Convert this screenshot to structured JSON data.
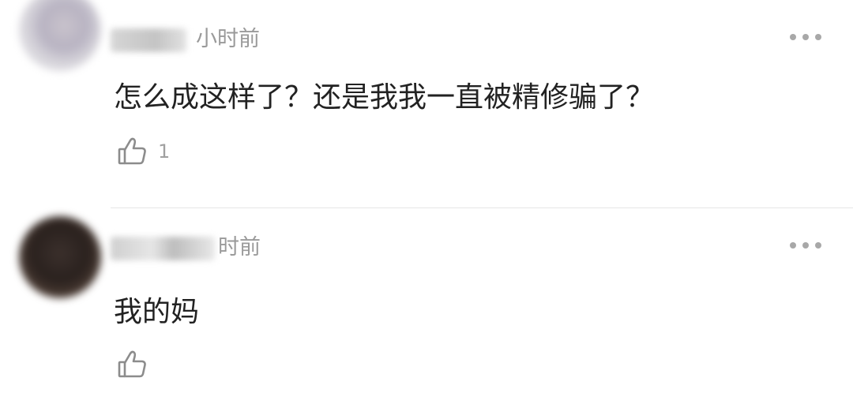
{
  "comments": [
    {
      "timestamp": "小时前",
      "text": "怎么成这样了？还是我我一直被精修骗了？",
      "likes": "1",
      "like_icon": "thumbs-up-outline-icon",
      "more_icon": "more-dots-icon"
    },
    {
      "timestamp": "时前",
      "text": "我的妈",
      "likes": "",
      "like_icon": "thumbs-up-outline-icon",
      "more_icon": "more-dots-icon"
    }
  ],
  "colors": {
    "text": "#222222",
    "muted": "#9a9a9a",
    "divider": "#e6e6e6"
  }
}
